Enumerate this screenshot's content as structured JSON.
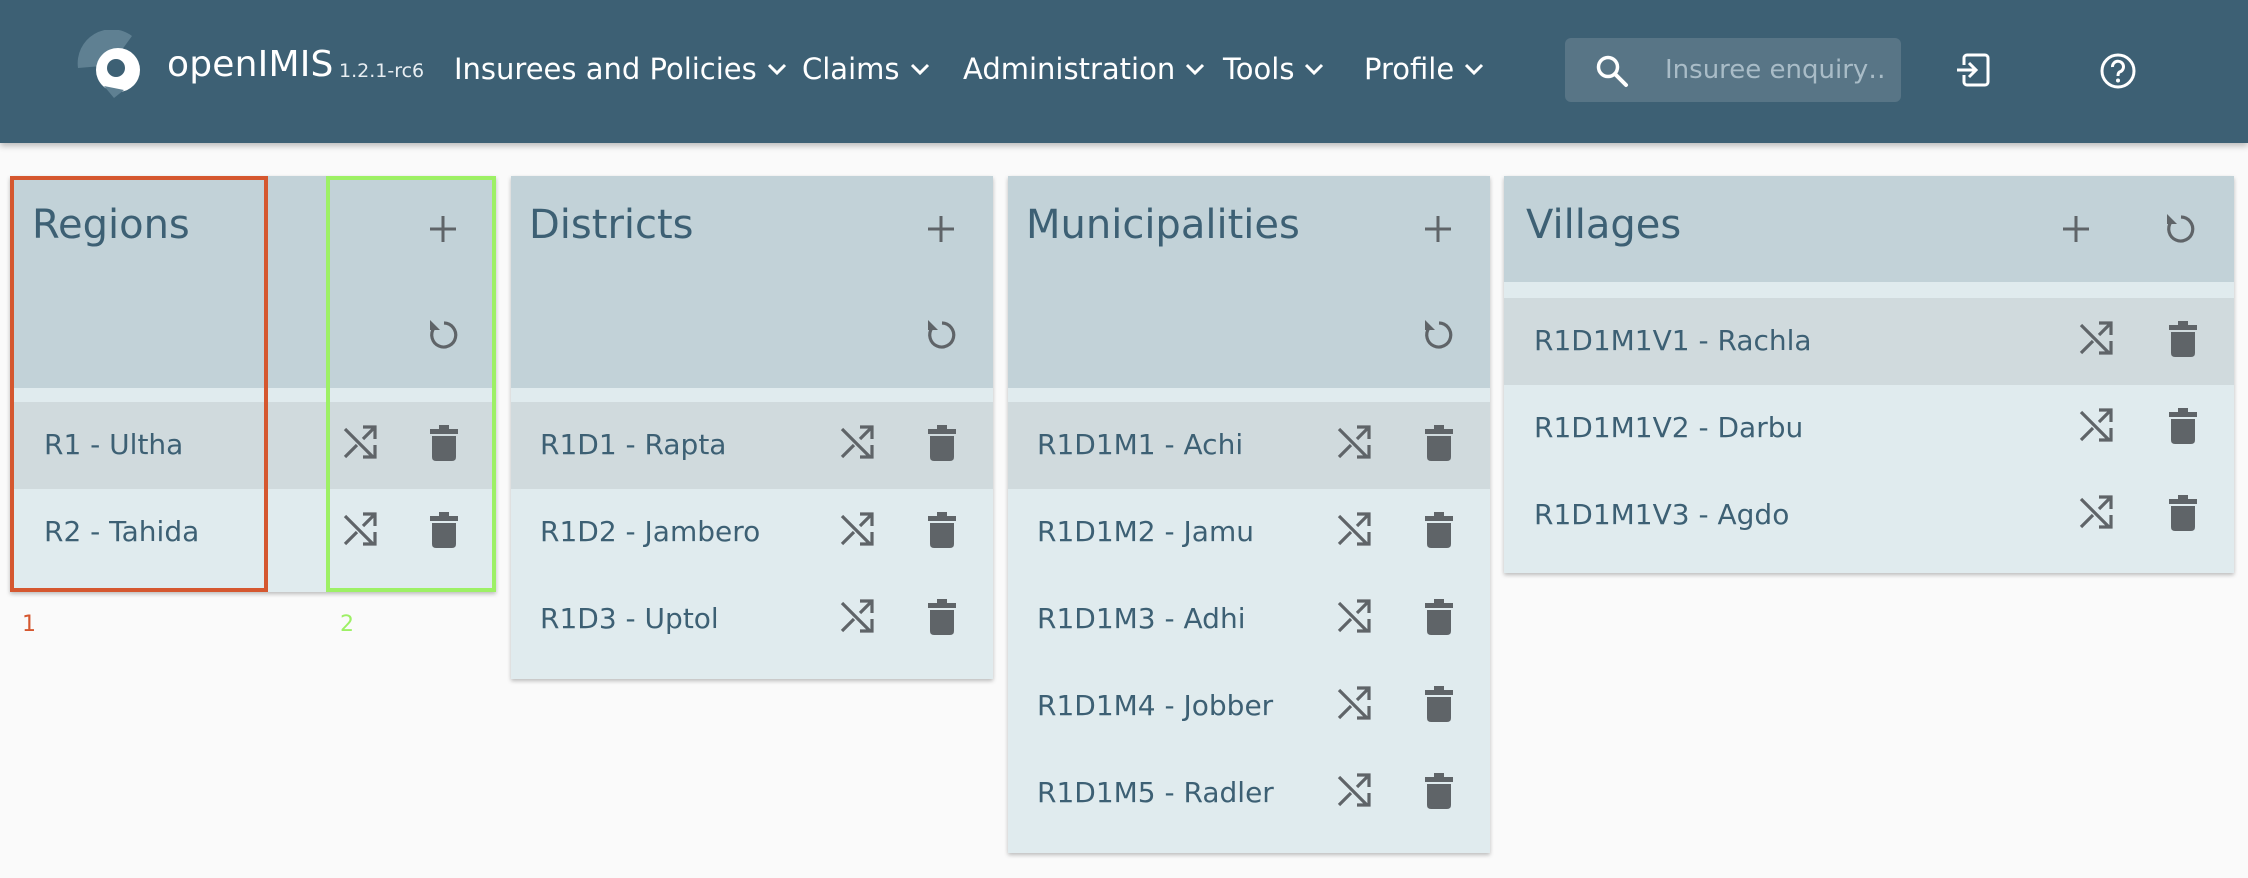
{
  "app": {
    "brand": "openIMIS",
    "version": "1.2.1-rc6"
  },
  "nav": {
    "menus": [
      {
        "label": "Insurees and Policies",
        "icon": "chevron-down-icon"
      },
      {
        "label": "Claims",
        "icon": "chevron-down-icon"
      },
      {
        "label": "Administration",
        "icon": "chevron-down-icon"
      },
      {
        "label": "Tools",
        "icon": "chevron-down-icon"
      },
      {
        "label": "Profile",
        "icon": "chevron-down-icon"
      }
    ],
    "search": {
      "placeholder": "Insuree enquiry…",
      "value": "",
      "icon": "search-icon"
    },
    "logout_icon": "logout-icon",
    "help_icon": "help-icon"
  },
  "regions": {
    "title": "Regions",
    "items": [
      {
        "label": "R1 - Ultha",
        "selected": true
      },
      {
        "label": "R2 - Tahida",
        "selected": false
      }
    ]
  },
  "districts": {
    "title": "Districts",
    "items": [
      {
        "label": "R1D1 - Rapta",
        "selected": true
      },
      {
        "label": "R1D2 - Jambero",
        "selected": false
      },
      {
        "label": "R1D3 - Uptol",
        "selected": false
      }
    ]
  },
  "municipalities": {
    "title": "Municipalities",
    "items": [
      {
        "label": "R1D1M1 - Achi",
        "selected": true
      },
      {
        "label": "R1D1M2 - Jamu",
        "selected": false
      },
      {
        "label": "R1D1M3 - Adhi",
        "selected": false
      },
      {
        "label": "R1D1M4 - Jobber",
        "selected": false
      },
      {
        "label": "R1D1M5 - Radler",
        "selected": false
      }
    ]
  },
  "villages": {
    "title": "Villages",
    "items": [
      {
        "label": "R1D1M1V1 - Rachla",
        "selected": true
      },
      {
        "label": "R1D1M1V2 - Darbu",
        "selected": false
      },
      {
        "label": "R1D1M1V3 - Agdo",
        "selected": false
      }
    ]
  },
  "annotations": [
    {
      "number": "1",
      "color": "#d5572f"
    },
    {
      "number": "2",
      "color": "#9df065"
    }
  ],
  "colors": {
    "appbar": "#3d6074",
    "card_header": "#c2d2d8",
    "card_body": "#e0ebee",
    "row_selected": "#d0dadd",
    "text": "#3d6074",
    "icon": "#5f6468"
  }
}
